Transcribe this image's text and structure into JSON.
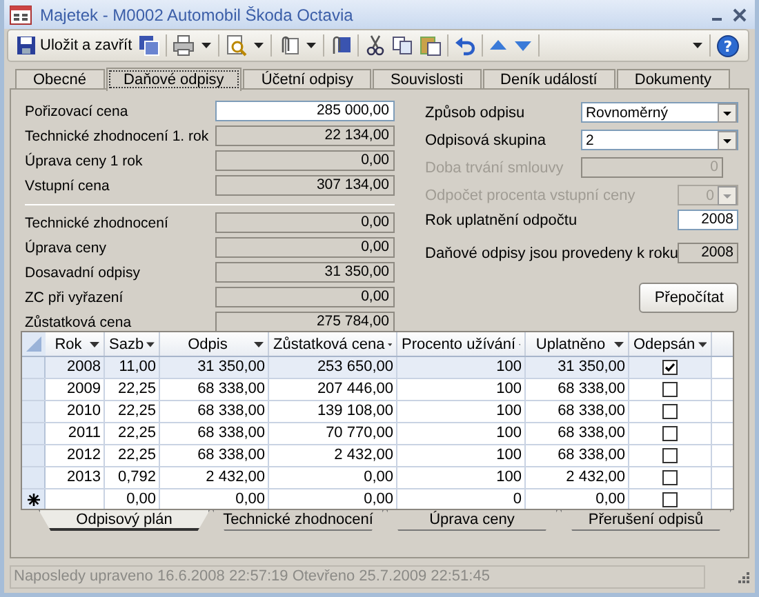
{
  "window": {
    "title": "Majetek - M0002 Automobil Škoda Octavia"
  },
  "toolbar": {
    "save_label": "Uložit a zavřít",
    "help_label": "?"
  },
  "tabs": [
    {
      "label": "Obecné",
      "selected": false
    },
    {
      "label": "Daňové odpisy",
      "selected": true
    },
    {
      "label": "Účetní odpisy",
      "selected": false
    },
    {
      "label": "Souvislosti",
      "selected": false
    },
    {
      "label": "Deník událostí",
      "selected": false
    },
    {
      "label": "Dokumenty",
      "selected": false
    }
  ],
  "price_fields": [
    {
      "label": "Pořizovací cena",
      "value": "285 000,00",
      "editable": true
    },
    {
      "label": "Technické zhodnocení 1. rok",
      "value": "22 134,00",
      "editable": false
    },
    {
      "label": "Úprava ceny 1 rok",
      "value": "0,00",
      "editable": false
    },
    {
      "label": "Vstupní cena",
      "value": "307 134,00",
      "editable": false
    }
  ],
  "value_fields": [
    {
      "label": "Technické zhodnocení",
      "value": "0,00",
      "editable": false
    },
    {
      "label": "Úprava ceny",
      "value": "0,00",
      "editable": false
    },
    {
      "label": "Dosavadní odpisy",
      "value": "31 350,00",
      "editable": false
    },
    {
      "label": "ZC při vyřazení",
      "value": "0,00",
      "editable": false
    },
    {
      "label": "Zůstatková cena",
      "value": "275 784,00",
      "editable": false
    }
  ],
  "settings": [
    {
      "label": "Způsob odpisu",
      "value": "Rovnoměrný",
      "kind": "combo",
      "disabled": false,
      "editable": true
    },
    {
      "label": "Odpisová skupina",
      "value": "2",
      "kind": "combo",
      "disabled": false,
      "editable": true
    },
    {
      "label": "Doba trvání smlouvy",
      "value": "0",
      "kind": "text",
      "disabled": true,
      "editable": false
    },
    {
      "label": "Odpočet procenta vstupní ceny",
      "value": "0",
      "kind": "combo",
      "disabled": true,
      "editable": false
    },
    {
      "label": "Rok uplatnění odpočtu",
      "value": "2008",
      "kind": "text",
      "disabled": false,
      "editable": true
    },
    {
      "label": "Daňové odpisy jsou provedeny k roku",
      "value": "2008",
      "kind": "text",
      "disabled": false,
      "editable": false
    }
  ],
  "recalc_button": "Přepočítat",
  "table": {
    "columns": [
      "Rok",
      "Sazb",
      "Odpis",
      "Zůstatková cena",
      "Procento užívání",
      "Uplatněno",
      "Odepsán"
    ],
    "rows": [
      {
        "cells": [
          "2008",
          "11,00",
          "31 350,00",
          "253 650,00",
          "100",
          "31 350,00"
        ],
        "checked": true,
        "selected": true,
        "new": false
      },
      {
        "cells": [
          "2009",
          "22,25",
          "68 338,00",
          "207 446,00",
          "100",
          "68 338,00"
        ],
        "checked": false,
        "selected": false,
        "new": false
      },
      {
        "cells": [
          "2010",
          "22,25",
          "68 338,00",
          "139 108,00",
          "100",
          "68 338,00"
        ],
        "checked": false,
        "selected": false,
        "new": false
      },
      {
        "cells": [
          "2011",
          "22,25",
          "68 338,00",
          "70 770,00",
          "100",
          "68 338,00"
        ],
        "checked": false,
        "selected": false,
        "new": false
      },
      {
        "cells": [
          "2012",
          "22,25",
          "68 338,00",
          "2 432,00",
          "100",
          "68 338,00"
        ],
        "checked": false,
        "selected": false,
        "new": false
      },
      {
        "cells": [
          "2013",
          "0,792",
          "2 432,00",
          "0,00",
          "100",
          "2 432,00"
        ],
        "checked": false,
        "selected": false,
        "new": false
      },
      {
        "cells": [
          "",
          "0,00",
          "0,00",
          "0,00",
          "0",
          "0,00"
        ],
        "checked": false,
        "selected": false,
        "new": true
      }
    ]
  },
  "sheet_tabs": [
    {
      "label": "Odpisový plán",
      "selected": true
    },
    {
      "label": "Technické zhodnocení",
      "selected": false
    },
    {
      "label": "Úprava ceny",
      "selected": false
    },
    {
      "label": "Přerušení odpisů",
      "selected": false
    }
  ],
  "status_bar": "Naposledy upraveno 16.6.2008 22:57:19 Otevřeno 25.7.2009 22:51:45"
}
